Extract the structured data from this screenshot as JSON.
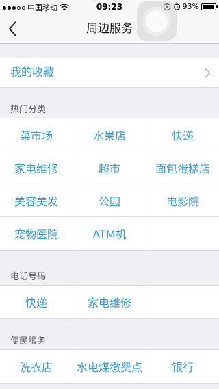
{
  "status_bar": {
    "carrier": "中国移动",
    "time": "09:23",
    "battery_text": "93%",
    "battery_level": 0.93
  },
  "nav": {
    "title": "周边服务",
    "back_icon": "chevron-left-icon"
  },
  "favorites": {
    "label": "我的收藏",
    "chevron_icon": "chevron-right-icon"
  },
  "hot_categories": {
    "header": "热门分类",
    "rows": [
      [
        "菜市场",
        "水果店",
        "快递"
      ],
      [
        "家电维修",
        "超市",
        "面包蛋糕店"
      ],
      [
        "美容美发",
        "公园",
        "电影院"
      ],
      [
        "宠物医院",
        "ATM机",
        ""
      ]
    ]
  },
  "phone_numbers": {
    "header": "电话号码",
    "rows": [
      [
        "快递",
        "家电维修",
        ""
      ]
    ]
  },
  "convenience": {
    "header": "便民服务",
    "rows": [
      [
        "洗衣店",
        "水电煤缴费点",
        "银行"
      ]
    ]
  },
  "colors": {
    "accent": "#3a9bd5",
    "background": "#efeff4",
    "separator": "#dadada"
  }
}
